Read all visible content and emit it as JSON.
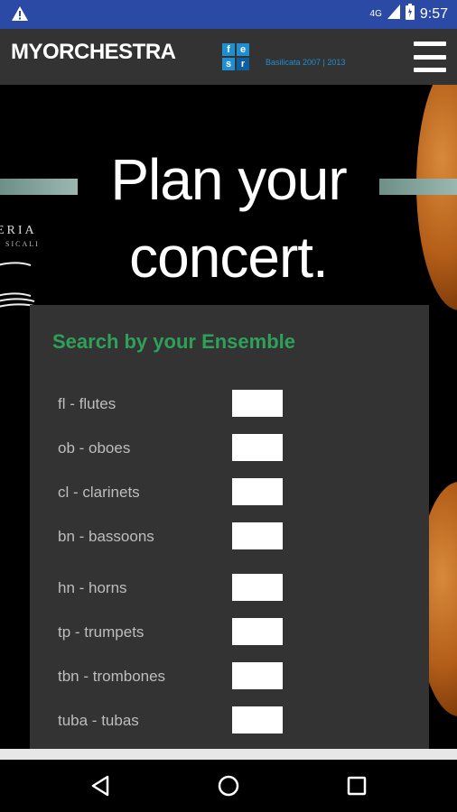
{
  "status_bar": {
    "network": "4G",
    "time": "9:57"
  },
  "header": {
    "logo_text": "MYORCHESTRA",
    "partner_letters": [
      "f",
      "e",
      "s",
      "r"
    ],
    "partner_caption": "Basilicata 2007 | 2013"
  },
  "hero": {
    "title_line1": "Plan your",
    "title_line2": "concert.",
    "side_text": "ERIA",
    "side_text_small": "SICALI"
  },
  "ensemble": {
    "title": "Search by your Ensemble",
    "rows": [
      {
        "label": "fl - flutes",
        "value": ""
      },
      {
        "label": "ob - oboes",
        "value": ""
      },
      {
        "label": "cl - clarinets",
        "value": ""
      },
      {
        "label": "bn - bassoons",
        "value": ""
      },
      {
        "label": "hn - horns",
        "value": ""
      },
      {
        "label": "tp - trumpets",
        "value": ""
      },
      {
        "label": "tbn - trombones",
        "value": ""
      },
      {
        "label": "tuba - tubas",
        "value": ""
      }
    ]
  },
  "colors": {
    "status_bar": "#2b4aa5",
    "header": "#333333",
    "panel": "#333333",
    "accent_green": "#2fa05a",
    "partner_blue": "#1f8fd0"
  }
}
